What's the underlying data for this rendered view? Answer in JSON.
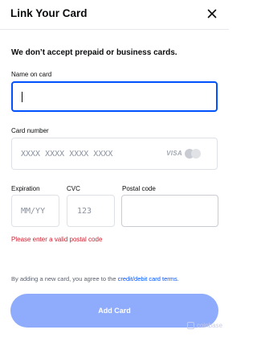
{
  "header": {
    "title": "Link Your Card"
  },
  "notice": "We don’t accept prepaid or business cards.",
  "fields": {
    "name": {
      "label": "Name on card",
      "value": ""
    },
    "card_number": {
      "label": "Card number",
      "placeholder": "XXXX XXXX XXXX XXXX",
      "brand_visa": "VISA"
    },
    "expiration": {
      "label": "Expiration",
      "placeholder": "MM/YY"
    },
    "cvc": {
      "label": "CVC",
      "placeholder": "123"
    },
    "postal": {
      "label": "Postal code",
      "value": ""
    }
  },
  "error": "Please enter a valid postal code",
  "terms": {
    "prefix": "By adding a new card, you agree to the ",
    "link": "credit/debit card terms",
    "suffix": "."
  },
  "button": {
    "label": "Add Card"
  },
  "watermark": "coinbase",
  "colors": {
    "primary": "#0052ff",
    "button_disabled": "#8fabfc",
    "error": "#cf202f"
  }
}
